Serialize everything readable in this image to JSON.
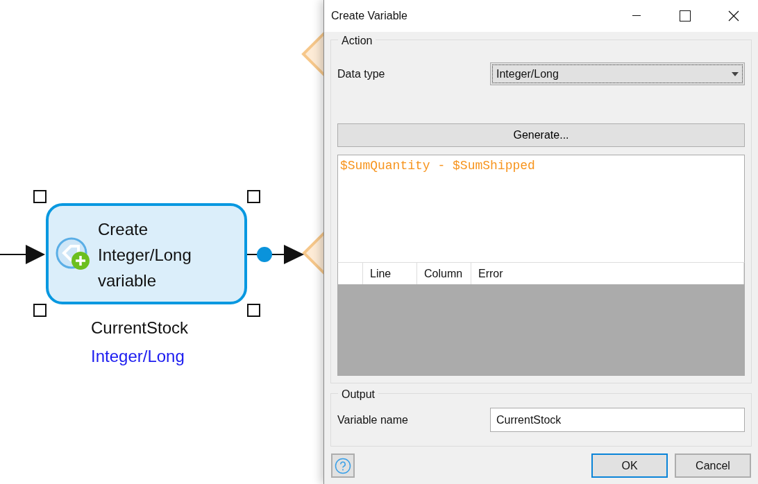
{
  "canvas": {
    "activity": {
      "title": "Create Integer/Long variable",
      "selected": true,
      "output_name": "CurrentStock",
      "output_type": "Integer/Long"
    }
  },
  "dialog": {
    "title": "Create Variable",
    "action": {
      "legend": "Action",
      "data_type_label": "Data type",
      "data_type": "Integer/Long",
      "generate_button": "Generate...",
      "expression": "$SumQuantity - $SumShipped",
      "error_columns": [
        "Line",
        "Column",
        "Error"
      ]
    },
    "output": {
      "legend": "Output",
      "variable_name_label": "Variable name",
      "variable_name": "CurrentStock"
    },
    "buttons": [
      {
        "label": "OK",
        "default": true
      },
      {
        "label": "Cancel",
        "default": false
      }
    ]
  }
}
